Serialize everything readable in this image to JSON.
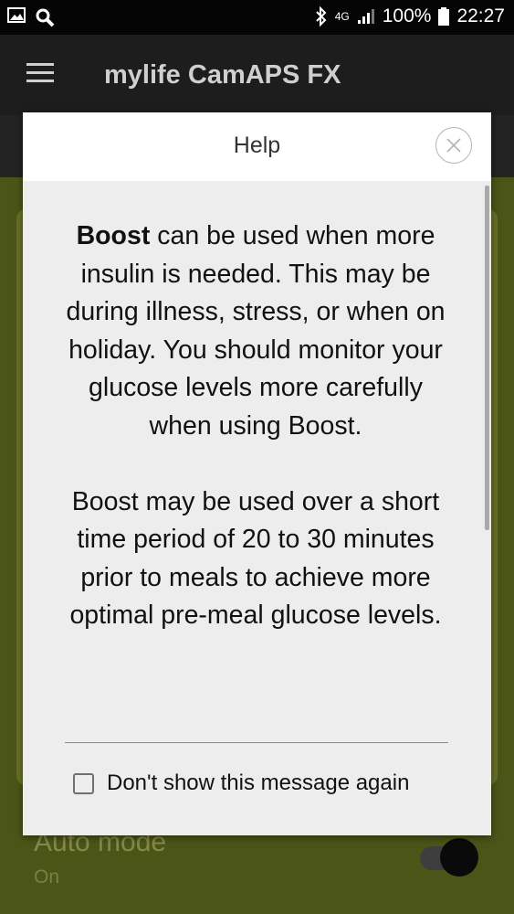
{
  "status_bar": {
    "network": "4G",
    "battery": "100%",
    "time": "22:27"
  },
  "app_bar": {
    "title": "mylife CamAPS FX"
  },
  "background": {
    "auto_mode_label": "Auto mode",
    "auto_mode_value": "On",
    "auto_mode_enabled": true
  },
  "dialog": {
    "title": "Help",
    "paragraph1_bold": "Boost",
    "paragraph1_rest": " can be used when more insulin is needed. This may be during illness, stress, or when on holiday. You should monitor your glucose levels more carefully when using Boost.",
    "paragraph2": "Boost may be used over a short time period of 20 to 30 minutes prior to meals to achieve more optimal pre-meal glucose levels.",
    "checkbox_label": "Don't show this message again",
    "checkbox_checked": false
  },
  "colors": {
    "background_green": "#4c5518",
    "card_green": "#6a7029",
    "app_bar": "#1d1d1d"
  }
}
